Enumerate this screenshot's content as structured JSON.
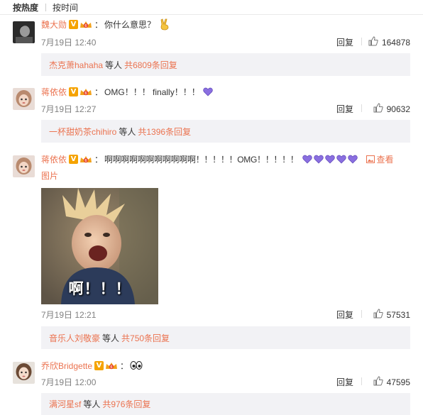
{
  "sort": {
    "hot_label": "按热度",
    "time_label": "按时间"
  },
  "colors": {
    "link": "#eb7350",
    "subbox_bg": "#f2f2f5",
    "heart": "#8a6fe0"
  },
  "comments": [
    {
      "username": "魏大勋",
      "vip_icon": "vip-crown-icon",
      "colon": "：",
      "text": "你什么意思？",
      "emoji": "victory-hand-emoji",
      "time": "7月19日 12:40",
      "reply_label": "回复",
      "likes": "164878",
      "sub_users": "杰克萧hahaha",
      "sub_mid": "等人",
      "sub_count": "共6809条回复"
    },
    {
      "username": "蒋依依",
      "vip_icon": "vip-crown-icon",
      "colon": "：",
      "text": "OMG！！！ finally！！！",
      "emoji": "purple-heart-emoji",
      "time": "7月19日 12:27",
      "reply_label": "回复",
      "likes": "90632",
      "sub_users": "一杯甜奶茶chihiro",
      "sub_mid": "等人",
      "sub_count": "共1396条回复"
    },
    {
      "username": "蒋依依",
      "vip_icon": "vip-crown-icon",
      "colon": "：",
      "text": "啊啊啊啊啊啊啊啊啊啊啊！！！！！OMG！！！！！",
      "emoji": "purple-heart-emoji",
      "emoji_count": 5,
      "view_pic_label": "查看",
      "view_pic_label2": "图片",
      "image_caption": "啊！！！",
      "time": "7月19日 12:21",
      "reply_label": "回复",
      "likes": "57531",
      "sub_users": "音乐人刘敬豪",
      "sub_mid": "等人",
      "sub_count": "共750条回复"
    },
    {
      "username": "乔欣Bridgette",
      "vip_icon": "vip-crown-icon",
      "colon": "：",
      "text": "",
      "emoji": "eyes-emoji",
      "time": "7月19日 12:00",
      "reply_label": "回复",
      "likes": "47595",
      "sub_users": "满河星sf",
      "sub_mid": "等人",
      "sub_count": "共976条回复"
    }
  ]
}
